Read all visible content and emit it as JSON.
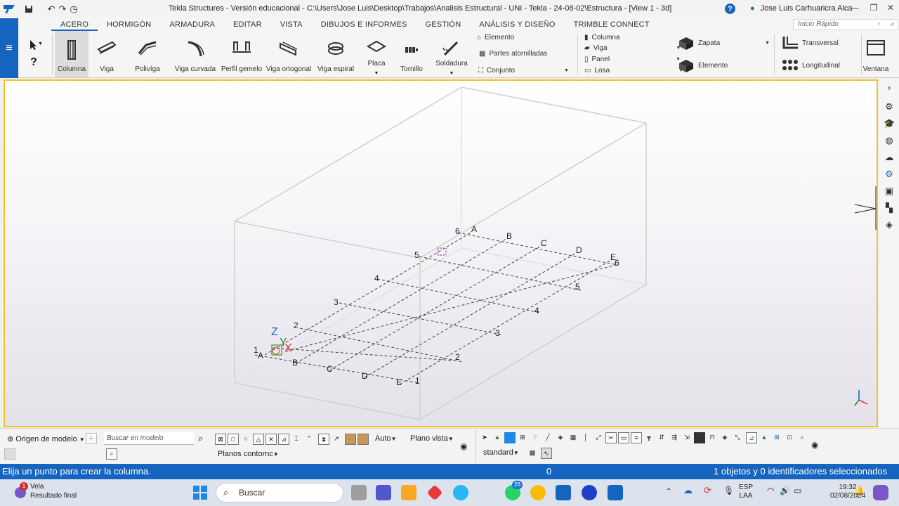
{
  "window": {
    "title": "Tekla Structures - Versión educacional - C:\\Users\\Jose Luis\\Desktop\\Trabajos\\Analisis Estructural - UNI - Tekla - 24-08-02\\Estructura  - [View 1 - 3d]",
    "user": "Jose Luis Carhuaricra Alca",
    "help_label": "?"
  },
  "ribbon": {
    "tabs": [
      "ACERO",
      "HORMIGÓN",
      "ARMADURA",
      "EDITAR",
      "VISTA",
      "DIBUJOS E INFORMES",
      "GESTIÓN",
      "ANÁLISIS Y DISEÑO",
      "TRIMBLE CONNECT"
    ],
    "active_tab": "ACERO",
    "quick_search_placeholder": "Inicio Rápido",
    "tools": [
      "Columna",
      "Viga",
      "Polivíga",
      "Viga curvada",
      "Perfil gemelo",
      "Viga ortogonal",
      "Viga espiral",
      "Placa",
      "Tornillo",
      "Soldadura"
    ],
    "selected_tool": "Columna",
    "small_tools": [
      "Elemento",
      "Partes atornilladas",
      "Conjunto"
    ],
    "concrete_tools": [
      "Columna",
      "Viga",
      "Panel",
      "Losa"
    ],
    "foundation_tools": [
      "Zapata",
      "Elemento"
    ],
    "section_tools": [
      "Transversal",
      "Longitudinal"
    ],
    "window_tool": "Ventana"
  },
  "viewport": {
    "grid_labels_letters": [
      "A",
      "B",
      "C",
      "D",
      "E"
    ],
    "grid_labels_numbers": [
      "1",
      "2",
      "3",
      "4",
      "5",
      "6"
    ],
    "axis_labels": {
      "z": "Z",
      "y": "Y",
      "x": "X"
    }
  },
  "bottom_toolbar": {
    "origin_select": "Origen de modelo",
    "search_placeholder": "Buscar en modelo",
    "auto_select": "Auto",
    "plane_select": "Plano vista",
    "contour_select": "Planos contornc",
    "standard_select": "standard"
  },
  "status": {
    "prompt": "Elija un punto para crear la columna.",
    "value": "0",
    "selection": "1 objetos y 0 identificadores seleccionados"
  },
  "taskbar": {
    "weather_title": "Vela",
    "weather_sub": "Resultado final",
    "weather_badge": "1",
    "search_label": "Buscar",
    "whatsapp_badge": "26",
    "lang_top": "ESP",
    "lang_bottom": "LAA",
    "time": "19:32",
    "date": "02/08/2024"
  },
  "colors": {
    "accent": "#1565c0",
    "viewport_border": "#f2c428",
    "axis_x": "#d32f2f",
    "axis_y": "#2e7d32",
    "axis_z": "#1565c0"
  }
}
